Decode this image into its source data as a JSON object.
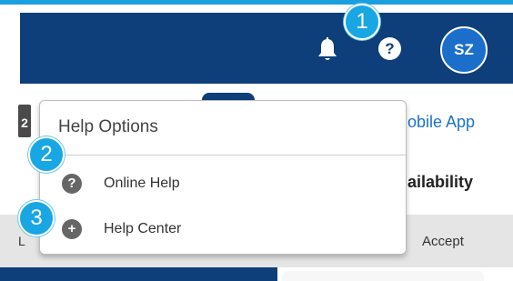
{
  "header": {
    "bell_icon": "bell-icon",
    "help_icon": "question-circle-icon",
    "help_glyph": "?",
    "avatar_initials": "SZ",
    "colors": {
      "header_bg": "#0f3f7a",
      "accent": "#1ba0df",
      "avatar_bg": "#1b6fcb"
    }
  },
  "callouts": [
    "1",
    "2",
    "3"
  ],
  "page": {
    "mobile_link": "obile App",
    "availability_label": "ailability",
    "accept_label": "Accept",
    "left_col_fragment": "L",
    "calendar_fragment": "2"
  },
  "help_menu": {
    "title": "Help Options",
    "items": [
      {
        "label": "Online Help",
        "icon": "question-circle-icon",
        "glyph": "?"
      },
      {
        "label": "Help Center",
        "icon": "plus-circle-icon",
        "glyph": "+"
      }
    ]
  }
}
